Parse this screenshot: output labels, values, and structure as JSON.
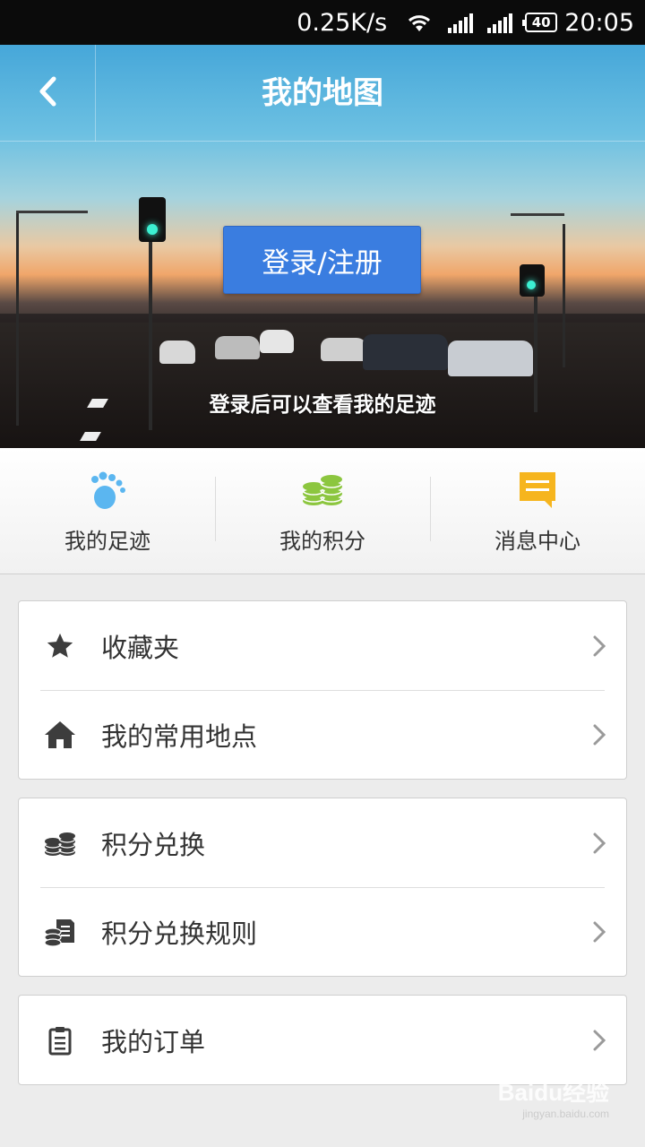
{
  "status_bar": {
    "speed": "0.25K/s",
    "battery": "40",
    "time": "20:05"
  },
  "header": {
    "title": "我的地图",
    "back_icon": "chevron-left-icon"
  },
  "hero": {
    "login_button": "登录/注册",
    "hint": "登录后可以查看我的足迹"
  },
  "quick_nav": [
    {
      "label": "我的足迹",
      "icon": "footprint-icon",
      "color": "#5bb6f0"
    },
    {
      "label": "我的积分",
      "icon": "coins-icon",
      "color": "#8cc63f"
    },
    {
      "label": "消息中心",
      "icon": "message-icon",
      "color": "#f6b51e"
    }
  ],
  "menu_groups": [
    {
      "items": [
        {
          "label": "收藏夹",
          "icon": "star-icon"
        },
        {
          "label": "我的常用地点",
          "icon": "home-icon"
        }
      ]
    },
    {
      "items": [
        {
          "label": "积分兑换",
          "icon": "coins-stack-icon"
        },
        {
          "label": "积分兑换规则",
          "icon": "coins-document-icon"
        }
      ]
    },
    {
      "items": [
        {
          "label": "我的订单",
          "icon": "clipboard-icon"
        }
      ]
    }
  ],
  "watermark": {
    "brand": "Baidu经验",
    "url": "jingyan.baidu.com"
  }
}
